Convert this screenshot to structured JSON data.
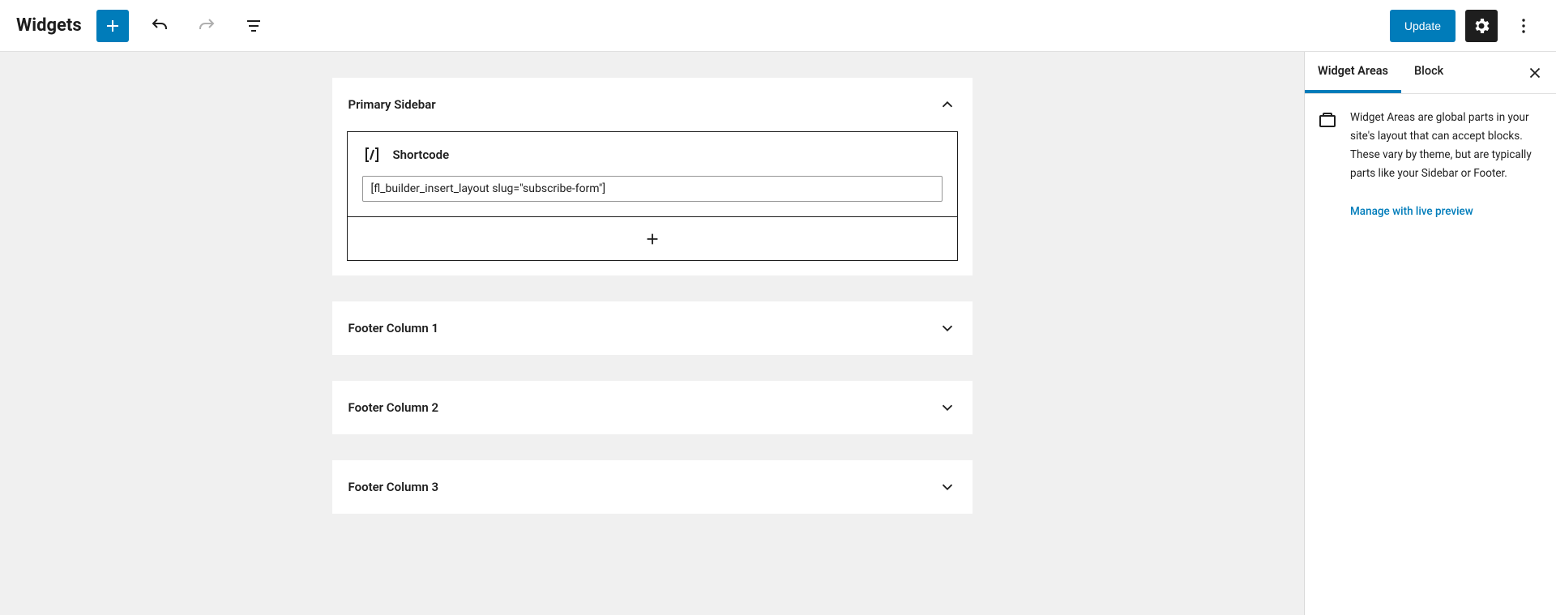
{
  "header": {
    "title": "Widgets",
    "update_label": "Update"
  },
  "widget_areas": [
    {
      "title": "Primary Sidebar",
      "expanded": true,
      "blocks": [
        {
          "type": "shortcode",
          "label": "Shortcode",
          "value": "[fl_builder_insert_layout slug=\"subscribe-form\"]"
        }
      ]
    },
    {
      "title": "Footer Column 1",
      "expanded": false
    },
    {
      "title": "Footer Column 2",
      "expanded": false
    },
    {
      "title": "Footer Column 3",
      "expanded": false
    }
  ],
  "sidebar": {
    "tabs": {
      "widget_areas": "Widget Areas",
      "block": "Block"
    },
    "description": "Widget Areas are global parts in your site's layout that can accept blocks. These vary by theme, but are typically parts like your Sidebar or Footer.",
    "manage_link": "Manage with live preview"
  }
}
